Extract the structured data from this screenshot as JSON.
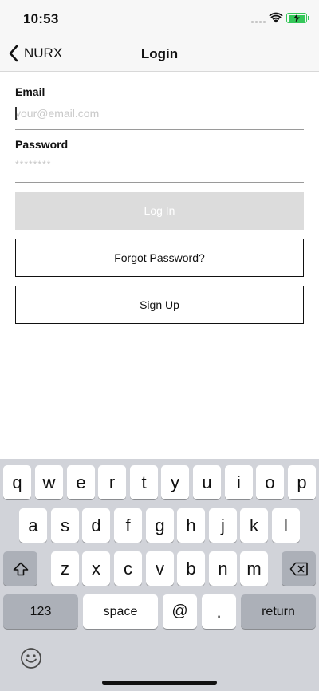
{
  "status_bar": {
    "time": "10:53"
  },
  "nav": {
    "back_label": "NURX",
    "title": "Login"
  },
  "form": {
    "email_label": "Email",
    "email_placeholder": "your@email.com",
    "email_value": "",
    "password_label": "Password",
    "password_placeholder": "********",
    "password_value": "",
    "login_label": "Log In",
    "forgot_label": "Forgot Password?",
    "signup_label": "Sign Up"
  },
  "keyboard": {
    "row1": [
      "q",
      "w",
      "e",
      "r",
      "t",
      "y",
      "u",
      "i",
      "o",
      "p"
    ],
    "row2": [
      "a",
      "s",
      "d",
      "f",
      "g",
      "h",
      "j",
      "k",
      "l"
    ],
    "row3": [
      "z",
      "x",
      "c",
      "v",
      "b",
      "n",
      "m"
    ],
    "numbers_label": "123",
    "space_label": "space",
    "at_label": "@",
    "period_label": ".",
    "return_label": "return",
    "shift_icon": "shift-arrow",
    "delete_icon": "backspace",
    "emoji_icon": "smiley-face"
  },
  "colors": {
    "battery": "#34c759",
    "login_disabled_bg": "#dcdcdc",
    "keyboard_bg": "#d1d3d9",
    "dark_key": "#acb0b8"
  }
}
